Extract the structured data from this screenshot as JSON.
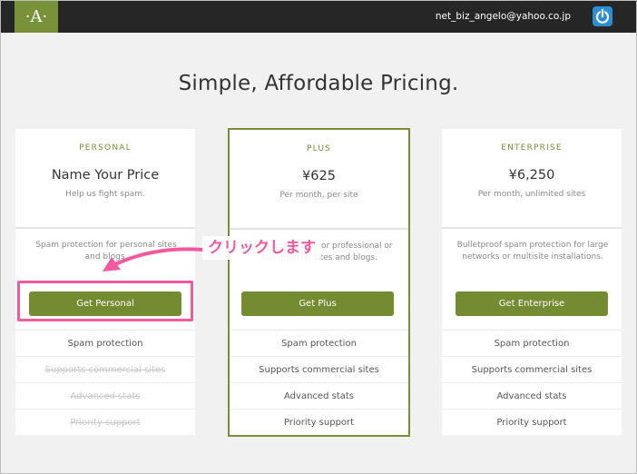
{
  "header": {
    "logo_text": "·A·",
    "user_email": "net_biz_angelo@yahoo.co.jp"
  },
  "headline": "Simple, Affordable Pricing.",
  "plans": [
    {
      "tier": "PERSONAL",
      "price": "Name Your Price",
      "subtitle": "Help us fight spam.",
      "description": "Spam protection for personal sites and blogs.",
      "button": "Get Personal",
      "features": [
        {
          "label": "Spam protection",
          "included": true
        },
        {
          "label": "Supports commercial sites",
          "included": false
        },
        {
          "label": "Advanced stats",
          "included": false
        },
        {
          "label": "Priority support",
          "included": false
        }
      ]
    },
    {
      "tier": "PLUS",
      "price": "¥625",
      "subtitle": "Per month, per site",
      "description": "Spam protection for professional or commercial sites and blogs.",
      "button": "Get Plus",
      "features": [
        {
          "label": "Spam protection",
          "included": true
        },
        {
          "label": "Supports commercial sites",
          "included": true
        },
        {
          "label": "Advanced stats",
          "included": true
        },
        {
          "label": "Priority support",
          "included": true
        }
      ]
    },
    {
      "tier": "ENTERPRISE",
      "price": "¥6,250",
      "subtitle": "Per month, unlimited sites",
      "description": "Bulletproof spam protection for large networks or multisite installations.",
      "button": "Get Enterprise",
      "features": [
        {
          "label": "Spam protection",
          "included": true
        },
        {
          "label": "Supports commercial sites",
          "included": true
        },
        {
          "label": "Advanced stats",
          "included": true
        },
        {
          "label": "Priority support",
          "included": true
        }
      ]
    }
  ],
  "annotation": {
    "callout_text": "クリックします",
    "color": "#f2599e"
  },
  "colors": {
    "accent": "#748b32",
    "topbar": "#262626",
    "power_button": "#2b8fd6"
  },
  "icons": {
    "power": "power-icon",
    "arrow": "arrow-icon"
  }
}
